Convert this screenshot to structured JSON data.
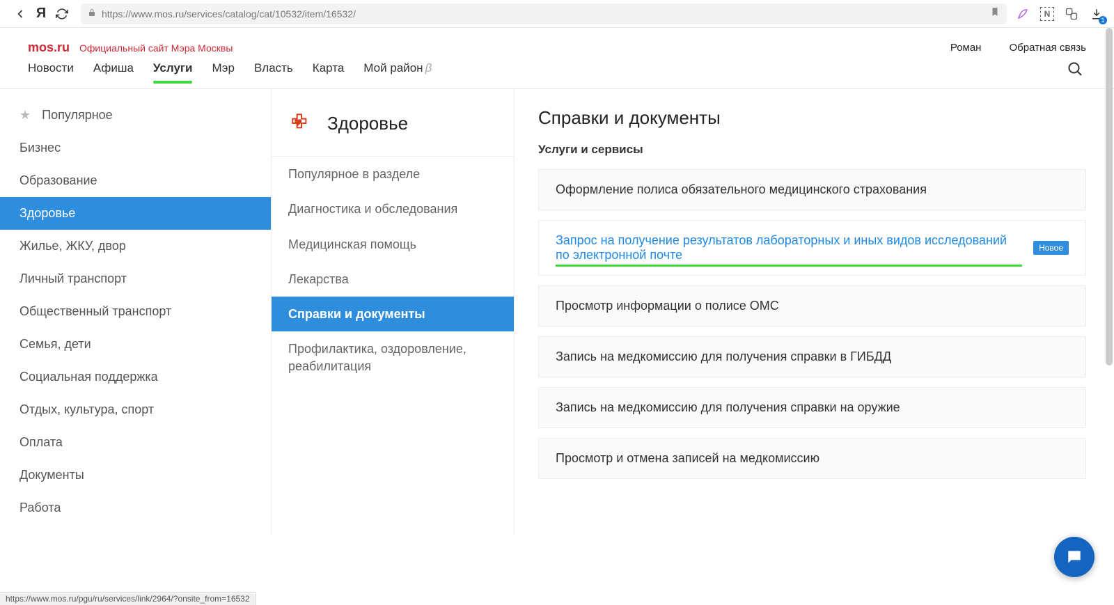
{
  "browser": {
    "url": "https://www.mos.ru/services/catalog/cat/10532/item/16532/",
    "status_bar_url": "https://www.mos.ru/pgu/ru/services/link/2964/?onsite_from=16532"
  },
  "header": {
    "brand": "mos.ru",
    "brand_sub": "Официальный сайт Мэра Москвы",
    "user_name": "Роман",
    "feedback": "Обратная связь"
  },
  "nav": {
    "items": [
      {
        "label": "Новости",
        "active": false
      },
      {
        "label": "Афиша",
        "active": false
      },
      {
        "label": "Услуги",
        "active": true
      },
      {
        "label": "Мэр",
        "active": false
      },
      {
        "label": "Власть",
        "active": false
      },
      {
        "label": "Карта",
        "active": false
      },
      {
        "label": "Мой район",
        "active": false,
        "beta": true
      }
    ],
    "beta_symbol": "β"
  },
  "sidebar": {
    "items": [
      {
        "label": "Популярное",
        "has_star": true,
        "selected": false
      },
      {
        "label": "Бизнес",
        "selected": false
      },
      {
        "label": "Образование",
        "selected": false
      },
      {
        "label": "Здоровье",
        "selected": true
      },
      {
        "label": "Жилье, ЖКУ, двор",
        "selected": false
      },
      {
        "label": "Личный транспорт",
        "selected": false
      },
      {
        "label": "Общественный транспорт",
        "selected": false
      },
      {
        "label": "Семья, дети",
        "selected": false
      },
      {
        "label": "Социальная поддержка",
        "selected": false
      },
      {
        "label": "Отдых, культура, спорт",
        "selected": false
      },
      {
        "label": "Оплата",
        "selected": false
      },
      {
        "label": "Документы",
        "selected": false
      },
      {
        "label": "Работа",
        "selected": false
      }
    ]
  },
  "section": {
    "title": "Здоровье",
    "items": [
      {
        "label": "Популярное в разделе",
        "selected": false
      },
      {
        "label": "Диагностика и обследования",
        "selected": false
      },
      {
        "label": "Медицинская помощь",
        "selected": false
      },
      {
        "label": "Лекарства",
        "selected": false
      },
      {
        "label": "Справки и документы",
        "selected": true
      },
      {
        "label": "Профилактика, оздоровление, реабилитация",
        "selected": false
      }
    ]
  },
  "main": {
    "title": "Справки и документы",
    "subtitle": "Услуги и сервисы",
    "badge_new": "Новое",
    "services": [
      {
        "label": "Оформление полиса обязательного медицинского страхования",
        "highlight": false
      },
      {
        "label": "Запрос на получение результатов лабораторных и иных видов исследований по электронной почте",
        "highlight": true,
        "badge": true
      },
      {
        "label": "Просмотр информации о полисе ОМС",
        "highlight": false
      },
      {
        "label": "Запись на медкомиссию для получения справки в ГИБДД",
        "highlight": false
      },
      {
        "label": "Запись на медкомиссию для получения справки на оружие",
        "highlight": false
      },
      {
        "label": "Просмотр и отмена записей на медкомиссию",
        "highlight": false
      }
    ]
  },
  "colors": {
    "accent_blue": "#2f8dde",
    "accent_green": "#3fd93f",
    "brand_red": "#cc2a36"
  }
}
